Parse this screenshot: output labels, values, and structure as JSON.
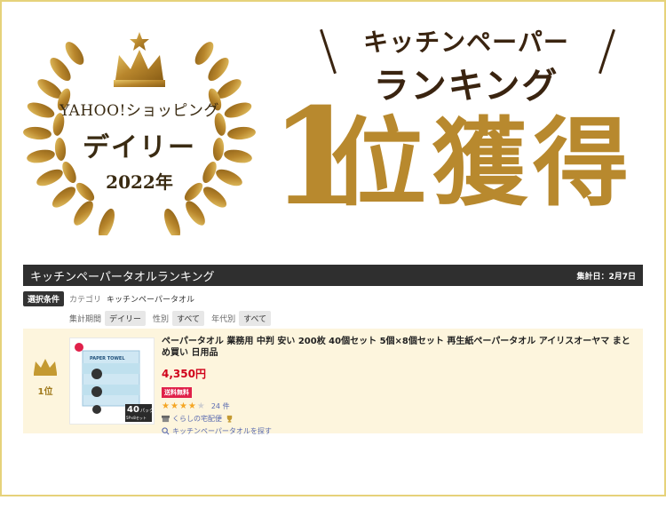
{
  "hero": {
    "store_label": "YAHOO!ショッピング",
    "daily_label": "デイリー",
    "year_label": "2022年",
    "headline_top": "キッチンペーパー",
    "headline_mid": "ランキング",
    "big_number": "1",
    "big_text": "位獲得"
  },
  "panel": {
    "title": "キッチンペーパータオルランキング",
    "date": "集計日：2月7日",
    "conditions_label": "選択条件",
    "category_label": "カテゴリ",
    "category_value": "キッチンペーパータオル",
    "filters": [
      {
        "label": "集計期間",
        "value": "デイリー"
      },
      {
        "label": "性別",
        "value": "すべて"
      },
      {
        "label": "年代別",
        "value": "すべて"
      }
    ]
  },
  "item": {
    "rank_label": "1位",
    "title": "ペーパータオル 業務用 中判 安い 200枚 40個セット 5個×8個セット 再生紙ペーパータオル アイリスオーヤマ まとめ買い 日用品",
    "price": "4,350円",
    "free_shipping": "送料無料",
    "rating": 4,
    "review_count": "24 件",
    "shop_name": "くらしの宅配便",
    "related_link": "キッチンペーパータオルを探す",
    "package_brand": "PAPER TOWEL",
    "package_count": "40",
    "package_unit": "パック",
    "package_note": "5P×8セット"
  },
  "colors": {
    "gold": "#b8892e",
    "frame": "#e6d27a",
    "header_dark": "#2f2f2f",
    "price_red": "#d0021b",
    "item_bg": "#fdf5dd"
  }
}
